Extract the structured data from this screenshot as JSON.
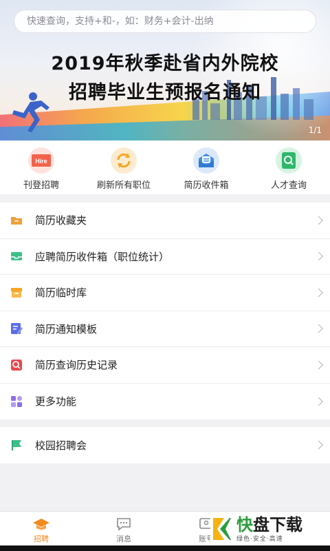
{
  "search": {
    "placeholder": "快速查询，支持+和-，如：财务+会计-出纳"
  },
  "banner": {
    "title_line1": "2019年秋季赴省内外院校",
    "title_line2": "招聘毕业生预报名通知",
    "page_indicator": "1/1"
  },
  "quick_actions": [
    {
      "label": "刊登招聘",
      "icon": "hire-icon",
      "icon_text": "Hire",
      "color": "#f2624b"
    },
    {
      "label": "刷新所有职位",
      "icon": "refresh-icon",
      "color": "#f5a623"
    },
    {
      "label": "简历收件箱",
      "icon": "resume-inbox-icon",
      "color": "#3d8fe8"
    },
    {
      "label": "人才查询",
      "icon": "talent-search-icon",
      "color": "#2fb86a"
    }
  ],
  "menu": [
    {
      "label": "简历收藏夹",
      "icon": "folder-icon",
      "color": "#f0a037"
    },
    {
      "label": "应聘简历收件箱（职位统计）",
      "icon": "inbox-icon",
      "color": "#3cc08a"
    },
    {
      "label": "简历临时库",
      "icon": "archive-box-icon",
      "color": "#f5a623"
    },
    {
      "label": "简历通知模板",
      "icon": "edit-template-icon",
      "color": "#5b6ee8"
    },
    {
      "label": "简历查询历史记录",
      "icon": "search-history-icon",
      "color": "#e9474b"
    },
    {
      "label": "更多功能",
      "icon": "grid-icon",
      "color": "#8f6ee8"
    }
  ],
  "menu2": [
    {
      "label": "校园招聘会",
      "icon": "flag-icon",
      "color": "#3cc08a"
    }
  ],
  "bottom_nav": [
    {
      "label": "招聘",
      "icon": "graduation-cap-icon",
      "active": true
    },
    {
      "label": "消息",
      "icon": "message-icon",
      "active": false
    },
    {
      "label": "账号",
      "icon": "account-icon",
      "active": false
    }
  ],
  "watermark": {
    "brand_prefix": "快",
    "brand": "盘下载",
    "tagline": "绿色·安全·高速"
  },
  "colors": {
    "accent": "#f28a1e",
    "background": "#f1f1f3"
  }
}
